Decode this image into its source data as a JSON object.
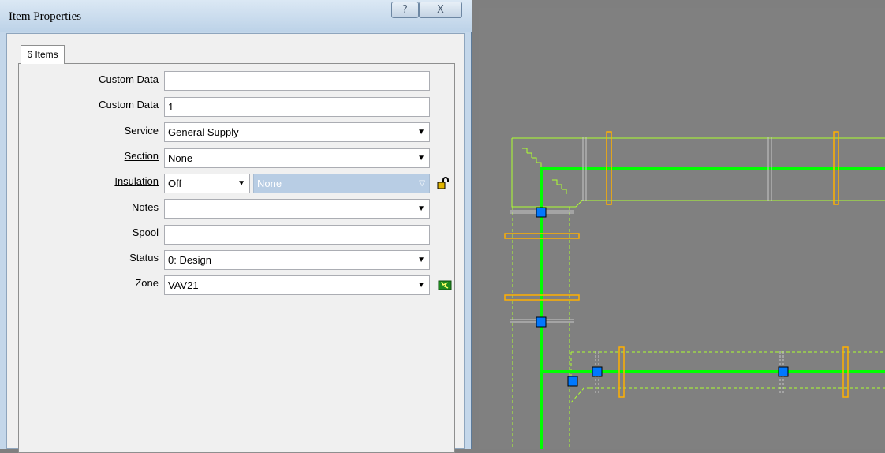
{
  "window": {
    "title": "Item Properties",
    "help_button": "?",
    "close_button": "X"
  },
  "tabs": [
    {
      "label": "6 Items"
    }
  ],
  "fields": {
    "custom_data_1": {
      "label": "Custom Data",
      "value": ""
    },
    "custom_data_2": {
      "label": "Custom Data",
      "value": "1"
    },
    "service": {
      "label": "Service",
      "value": "General Supply"
    },
    "section": {
      "label": "Section",
      "value": "None"
    },
    "insulation": {
      "label": "Insulation",
      "value": "Off",
      "spec_value": "None"
    },
    "notes": {
      "label": "Notes",
      "value": ""
    },
    "spool": {
      "label": "Spool",
      "value": ""
    },
    "status": {
      "label": "Status",
      "value": "0: Design"
    },
    "zone": {
      "label": "Zone",
      "value": "VAV21"
    }
  },
  "icons": {
    "lock": "unlock-padlock-icon",
    "zone_new": "new-zone-icon",
    "dropdown": "chevron-down-icon"
  },
  "colors": {
    "duct_centerline": "#00ff00",
    "duct_outline": "#adff2f",
    "hanger": "#ffb000",
    "node": "#0078ff",
    "canvas_bg": "#808080"
  }
}
